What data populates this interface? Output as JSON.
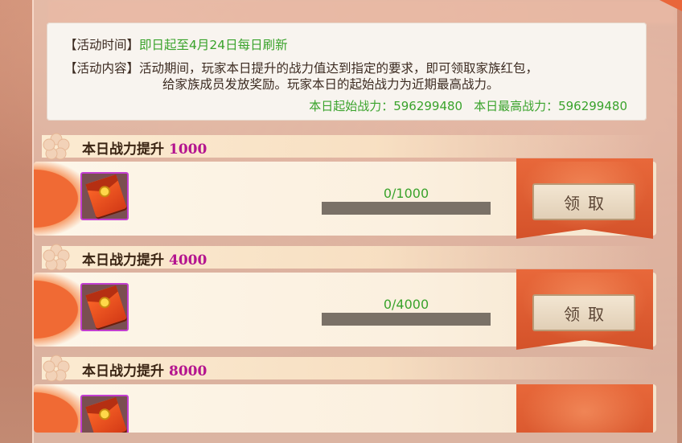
{
  "activity": {
    "time_label": "【活动时间】",
    "time_value": "即日起至4月24日每日刷新",
    "content_label": "【活动内容】",
    "content_line1": "活动期间，玩家本日提升的战力值达到指定的要求，即可领取家族红包，",
    "content_line2": "给家族成员发放奖励。玩家本日的起始战力为近期最高战力。",
    "start_power": "本日起始战力：596299480",
    "max_power": "本日最高战力：596299480"
  },
  "tiers": [
    {
      "title": "本日战力提升",
      "target": "1000",
      "progress_text": "0/1000",
      "progress": 0,
      "claim_label": "领取",
      "reward_icon": "red-envelope-icon"
    },
    {
      "title": "本日战力提升",
      "target": "4000",
      "progress_text": "0/4000",
      "progress": 0,
      "claim_label": "领取",
      "reward_icon": "red-envelope-icon"
    },
    {
      "title": "本日战力提升",
      "target": "8000",
      "progress_text": "",
      "progress": 0,
      "claim_label": "",
      "reward_icon": "red-envelope-icon"
    }
  ],
  "colors": {
    "accent_green": "#3aa32c",
    "target_magenta": "#b4148f",
    "ribbon": "#e8683a"
  }
}
